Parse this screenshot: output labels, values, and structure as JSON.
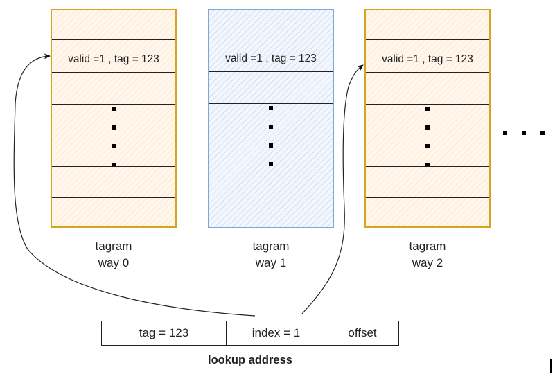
{
  "diagram": {
    "tagrams": [
      {
        "id": "way0",
        "title": "tagram",
        "subtitle": "way 0",
        "color": "#d6a520",
        "fill": "#fff6ec",
        "entry": "valid =1 , tag = 123"
      },
      {
        "id": "way1",
        "title": "tagram",
        "subtitle": "way 1",
        "color": "#7ea6d8",
        "fill": "#f3f7fd",
        "entry": "valid =1 , tag = 123"
      },
      {
        "id": "way2",
        "title": "tagram",
        "subtitle": "way 2",
        "color": "#d6a520",
        "fill": "#fff6ec",
        "entry": "valid =1 , tag = 123"
      }
    ],
    "more_ways_indicator": "...",
    "lookup_address": {
      "title": "lookup address",
      "fields": [
        {
          "name": "tag",
          "label": "tag = 123"
        },
        {
          "name": "index",
          "label": "index = 1"
        },
        {
          "name": "offset",
          "label": "offset"
        }
      ]
    },
    "arrows": [
      {
        "from": "lookup-address-tag",
        "to": "tagram-way0-entry-1"
      },
      {
        "from": "lookup-address-index",
        "to": "tagram-way2-entry-1"
      }
    ]
  }
}
